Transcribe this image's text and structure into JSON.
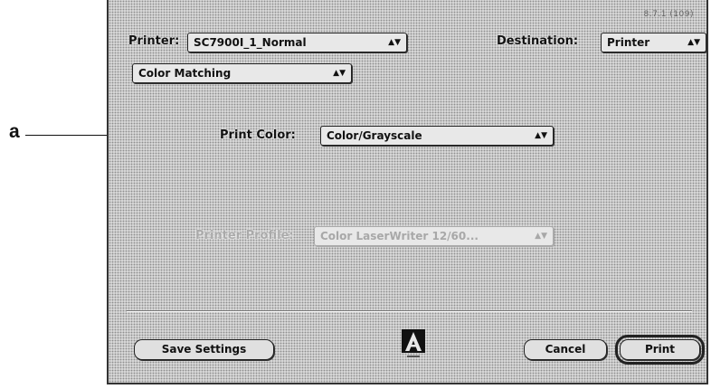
{
  "callout": {
    "letter": "a"
  },
  "dialog": {
    "version": "8.7.1 (109)",
    "printer_label": "Printer:",
    "printer_value": "SC7900I_1_Normal",
    "destination_label": "Destination:",
    "destination_value": "Printer",
    "panel_value": "Color Matching",
    "print_color_label": "Print Color:",
    "print_color_value": "Color/Grayscale",
    "printer_profile_label": "Printer Profile:",
    "printer_profile_value": "Color LaserWriter 12/60...",
    "save_settings_label": "Save Settings",
    "cancel_label": "Cancel",
    "print_label": "Print",
    "popup_arrows_glyph": "▲▼",
    "logo_icon": "adobe-logo-icon"
  }
}
